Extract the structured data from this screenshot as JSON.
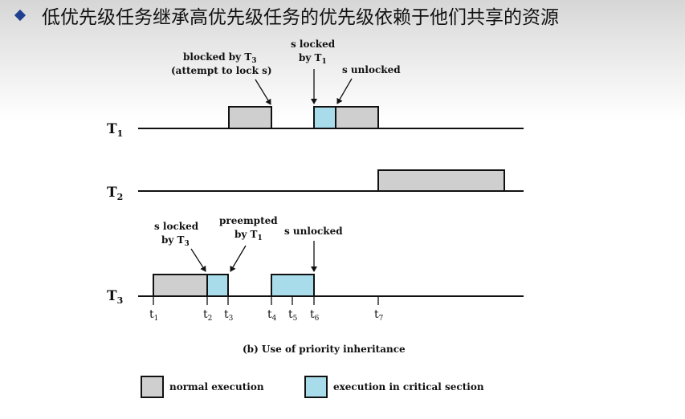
{
  "header": {
    "title": "低优先级任务继承高优先级任务的优先级依赖于他们共享的资源"
  },
  "tasks": [
    {
      "name": "T",
      "sub": "1"
    },
    {
      "name": "T",
      "sub": "2"
    },
    {
      "name": "T",
      "sub": "3"
    }
  ],
  "ticks": [
    {
      "t": "t",
      "s": "1"
    },
    {
      "t": "t",
      "s": "2"
    },
    {
      "t": "t",
      "s": "3"
    },
    {
      "t": "t",
      "s": "4"
    },
    {
      "t": "t",
      "s": "5"
    },
    {
      "t": "t",
      "s": "6"
    },
    {
      "t": "t",
      "s": "7"
    }
  ],
  "annotations": {
    "blocked_line1": "blocked by T",
    "blocked_sub": "3",
    "blocked_line2": "(attempt to lock s)",
    "t1_slocked_line1": "s locked",
    "t1_slocked_line2": "by T",
    "t1_slocked_sub": "1",
    "t1_sunlocked": "s unlocked",
    "t3_slocked_line1": "s locked",
    "t3_slocked_line2": "by T",
    "t3_slocked_sub": "3",
    "preempted_line1": "preempted",
    "preempted_line2": "by T",
    "preempted_sub": "1",
    "t3_sunlocked": "s unlocked"
  },
  "caption": "(b) Use of priority inheritance",
  "legend": {
    "normal": "normal execution",
    "critical": "execution in critical section"
  },
  "colors": {
    "normal": "#cfcfcf",
    "critical": "#a8dcea",
    "title_bullet": "#1f3f8f"
  }
}
